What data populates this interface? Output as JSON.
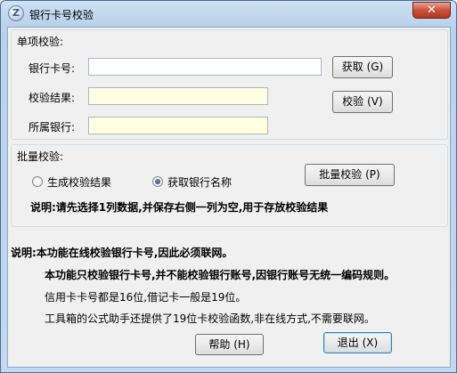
{
  "window": {
    "title": "银行卡号校验",
    "close_label": "✕"
  },
  "single_check": {
    "group_title": "单项校验:",
    "card_number_label": "银行卡号:",
    "card_number_value": "",
    "result_label": "校验结果:",
    "result_value": "",
    "bank_label": "所属银行:",
    "bank_value": "",
    "get_button": "获取 (G)",
    "check_button": "校验 (V)"
  },
  "batch_check": {
    "group_title": "批量校验:",
    "option_generate": "生成校验结果",
    "option_bank_name": "获取银行名称",
    "selected_option": "option_bank_name",
    "batch_button": "批量校验 (P)",
    "note": "说明:请先选择1列数据,并保存右侧一列为空,用于存放校验结果"
  },
  "notes": {
    "line1": "说明:本功能在线校验银行卡号,因此必须联网。",
    "line2": "本功能只校验银行卡号,并不能校验银行账号,因银行账号无统一编码规则。",
    "line3": "信用卡卡号都是16位,借记卡一般是19位。",
    "line4": "工具箱的公式助手还提供了19位卡校验函数,非在线方式,不需要联网。"
  },
  "footer": {
    "help_button": "帮助 (H)",
    "exit_button": "退出 (X)"
  }
}
